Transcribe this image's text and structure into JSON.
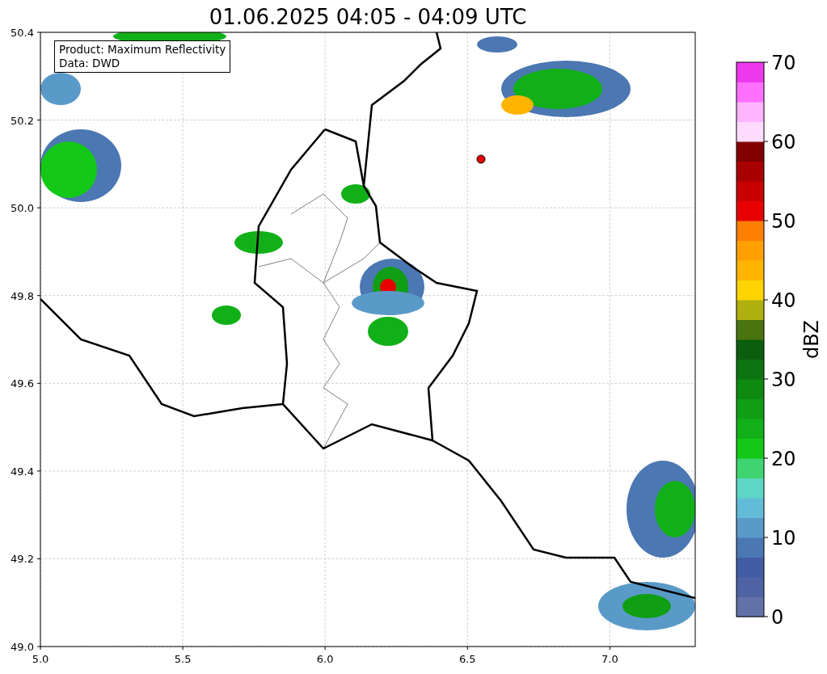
{
  "title": "01.06.2025 04:05 - 04:09 UTC",
  "legend": [
    "Product: Maximum Reflectivity",
    "Data: DWD"
  ],
  "x_ticks": [
    "5.0",
    "5.5",
    "6.0",
    "6.5",
    "7.0"
  ],
  "y_ticks": [
    "50.4",
    "50.2",
    "50.0",
    "49.8",
    "49.6",
    "49.4",
    "49.2",
    "49.0"
  ],
  "colorbar": {
    "label": "dBZ",
    "ticks": [
      "70",
      "60",
      "50",
      "40",
      "30",
      "20",
      "10",
      "0"
    ],
    "bands": [
      {
        "color": "#6272a8"
      },
      {
        "color": "#4f63a4"
      },
      {
        "color": "#435da4"
      },
      {
        "color": "#4b77b2"
      },
      {
        "color": "#5a9ac8"
      },
      {
        "color": "#62bcd8"
      },
      {
        "color": "#5ed6c6"
      },
      {
        "color": "#3ed470"
      },
      {
        "color": "#14c818"
      },
      {
        "color": "#12b018"
      },
      {
        "color": "#109e14"
      },
      {
        "color": "#0e8a10"
      },
      {
        "color": "#0c7410"
      },
      {
        "color": "#0a5e0e"
      },
      {
        "color": "#4a7410"
      },
      {
        "color": "#b0b010"
      },
      {
        "color": "#ffd400"
      },
      {
        "color": "#ffb400"
      },
      {
        "color": "#ffa000"
      },
      {
        "color": "#ff8000"
      },
      {
        "color": "#e80000"
      },
      {
        "color": "#c80000"
      },
      {
        "color": "#a80000"
      },
      {
        "color": "#800000"
      },
      {
        "color": "#ffdcff"
      },
      {
        "color": "#ffb4ff"
      },
      {
        "color": "#ff70ff"
      },
      {
        "color": "#ee38ee"
      }
    ]
  }
}
